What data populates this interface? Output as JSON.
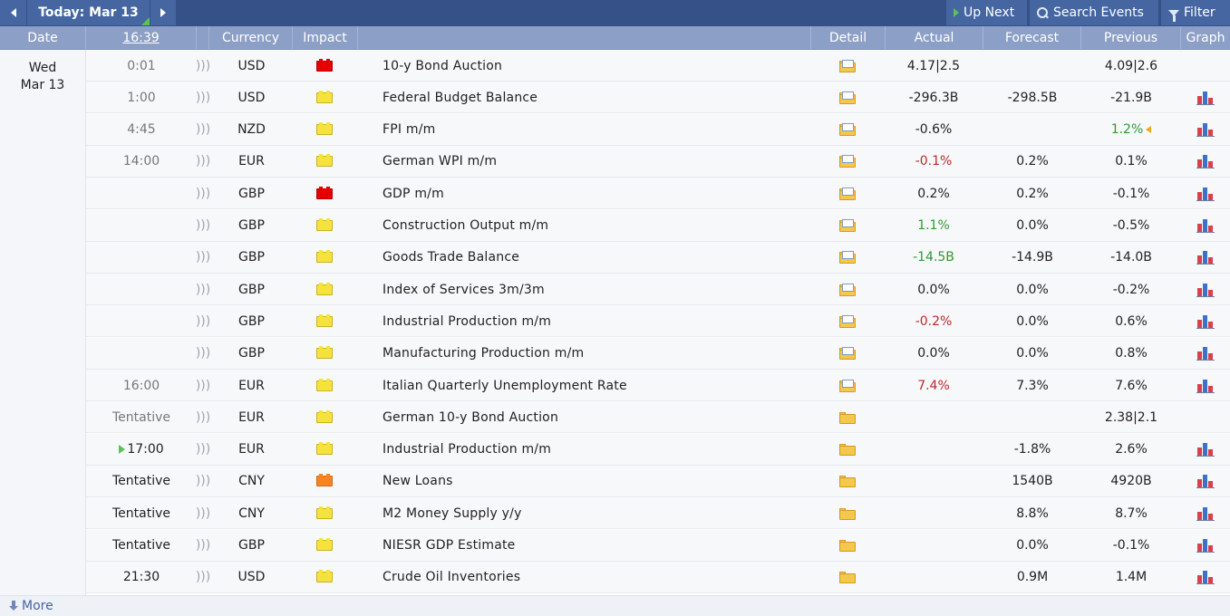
{
  "toolbar": {
    "today_label": "Today: Mar 13",
    "up_next_label": "Up Next",
    "search_label": "Search Events",
    "filter_label": "Filter"
  },
  "header": {
    "date": "Date",
    "time": "16:39",
    "currency": "Currency",
    "impact": "Impact",
    "detail": "Detail",
    "actual": "Actual",
    "forecast": "Forecast",
    "previous": "Previous",
    "graph": "Graph"
  },
  "date": {
    "day": "Wed",
    "date": "Mar 13"
  },
  "colors": {
    "high": "#e60000",
    "medium": "#f78422",
    "low": "#f6e23c",
    "header": "#8c9fc6",
    "toolbar": "#355187"
  },
  "rows": [
    {
      "time": "0:01",
      "currency": "USD",
      "impact": "high",
      "event": "10-y Bond Auction",
      "actual": "4.17|2.5",
      "actual_color": "plain",
      "forecast": "",
      "previous": "4.09|2.6",
      "graph": false,
      "detail": "full"
    },
    {
      "time": "1:00",
      "currency": "USD",
      "impact": "low",
      "event": "Federal Budget Balance",
      "actual": "-296.3B",
      "actual_color": "plain",
      "forecast": "-298.5B",
      "previous": "-21.9B",
      "graph": true,
      "detail": "full"
    },
    {
      "time": "4:45",
      "currency": "NZD",
      "impact": "low",
      "event": "FPI m/m",
      "actual": "-0.6%",
      "actual_color": "plain",
      "forecast": "",
      "previous": "1.2%",
      "previous_color": "green",
      "revised": true,
      "graph": true,
      "detail": "full"
    },
    {
      "time": "14:00",
      "currency": "EUR",
      "impact": "low",
      "event": "German WPI m/m",
      "actual": "-0.1%",
      "actual_color": "red",
      "forecast": "0.2%",
      "previous": "0.1%",
      "graph": true,
      "detail": "full"
    },
    {
      "time": "",
      "currency": "GBP",
      "impact": "high",
      "event": "GDP m/m",
      "actual": "0.2%",
      "actual_color": "plain",
      "forecast": "0.2%",
      "previous": "-0.1%",
      "graph": true,
      "detail": "full"
    },
    {
      "time": "",
      "currency": "GBP",
      "impact": "low",
      "event": "Construction Output m/m",
      "actual": "1.1%",
      "actual_color": "green",
      "forecast": "0.0%",
      "previous": "-0.5%",
      "graph": true,
      "detail": "full"
    },
    {
      "time": "",
      "currency": "GBP",
      "impact": "low",
      "event": "Goods Trade Balance",
      "actual": "-14.5B",
      "actual_color": "green",
      "forecast": "-14.9B",
      "previous": "-14.0B",
      "graph": true,
      "detail": "full"
    },
    {
      "time": "",
      "currency": "GBP",
      "impact": "low",
      "event": "Index of Services 3m/3m",
      "actual": "0.0%",
      "actual_color": "plain",
      "forecast": "0.0%",
      "previous": "-0.2%",
      "graph": true,
      "detail": "full"
    },
    {
      "time": "",
      "currency": "GBP",
      "impact": "low",
      "event": "Industrial Production m/m",
      "actual": "-0.2%",
      "actual_color": "red",
      "forecast": "0.0%",
      "previous": "0.6%",
      "graph": true,
      "detail": "full"
    },
    {
      "time": "",
      "currency": "GBP",
      "impact": "low",
      "event": "Manufacturing Production m/m",
      "actual": "0.0%",
      "actual_color": "plain",
      "forecast": "0.0%",
      "previous": "0.8%",
      "graph": true,
      "detail": "full"
    },
    {
      "time": "16:00",
      "currency": "EUR",
      "impact": "low",
      "event": "Italian Quarterly Unemployment Rate",
      "actual": "7.4%",
      "actual_color": "red",
      "forecast": "7.3%",
      "previous": "7.6%",
      "graph": true,
      "detail": "full"
    },
    {
      "time": "Tentative",
      "currency": "EUR",
      "impact": "low",
      "event": "German 10-y Bond Auction",
      "actual": "",
      "actual_color": "plain",
      "forecast": "",
      "previous": "2.38|2.1",
      "graph": false,
      "detail": "empty"
    },
    {
      "time": "17:00",
      "currency": "EUR",
      "impact": "low",
      "event": "Industrial Production m/m",
      "actual": "",
      "actual_color": "plain",
      "forecast": "-1.8%",
      "previous": "2.6%",
      "graph": true,
      "detail": "empty",
      "next": true
    },
    {
      "time": "Tentative",
      "currency": "CNY",
      "impact": "medium",
      "event": "New Loans",
      "actual": "",
      "actual_color": "plain",
      "forecast": "1540B",
      "previous": "4920B",
      "graph": true,
      "detail": "empty"
    },
    {
      "time": "Tentative",
      "currency": "CNY",
      "impact": "low",
      "event": "M2 Money Supply y/y",
      "actual": "",
      "actual_color": "plain",
      "forecast": "8.8%",
      "previous": "8.7%",
      "graph": true,
      "detail": "empty"
    },
    {
      "time": "Tentative",
      "currency": "GBP",
      "impact": "low",
      "event": "NIESR GDP Estimate",
      "actual": "",
      "actual_color": "plain",
      "forecast": "0.0%",
      "previous": "-0.1%",
      "graph": true,
      "detail": "empty"
    },
    {
      "time": "21:30",
      "currency": "USD",
      "impact": "low",
      "event": "Crude Oil Inventories",
      "actual": "",
      "actual_color": "plain",
      "forecast": "0.9M",
      "previous": "1.4M",
      "graph": true,
      "detail": "empty"
    }
  ],
  "footer": {
    "more_label": "More"
  }
}
